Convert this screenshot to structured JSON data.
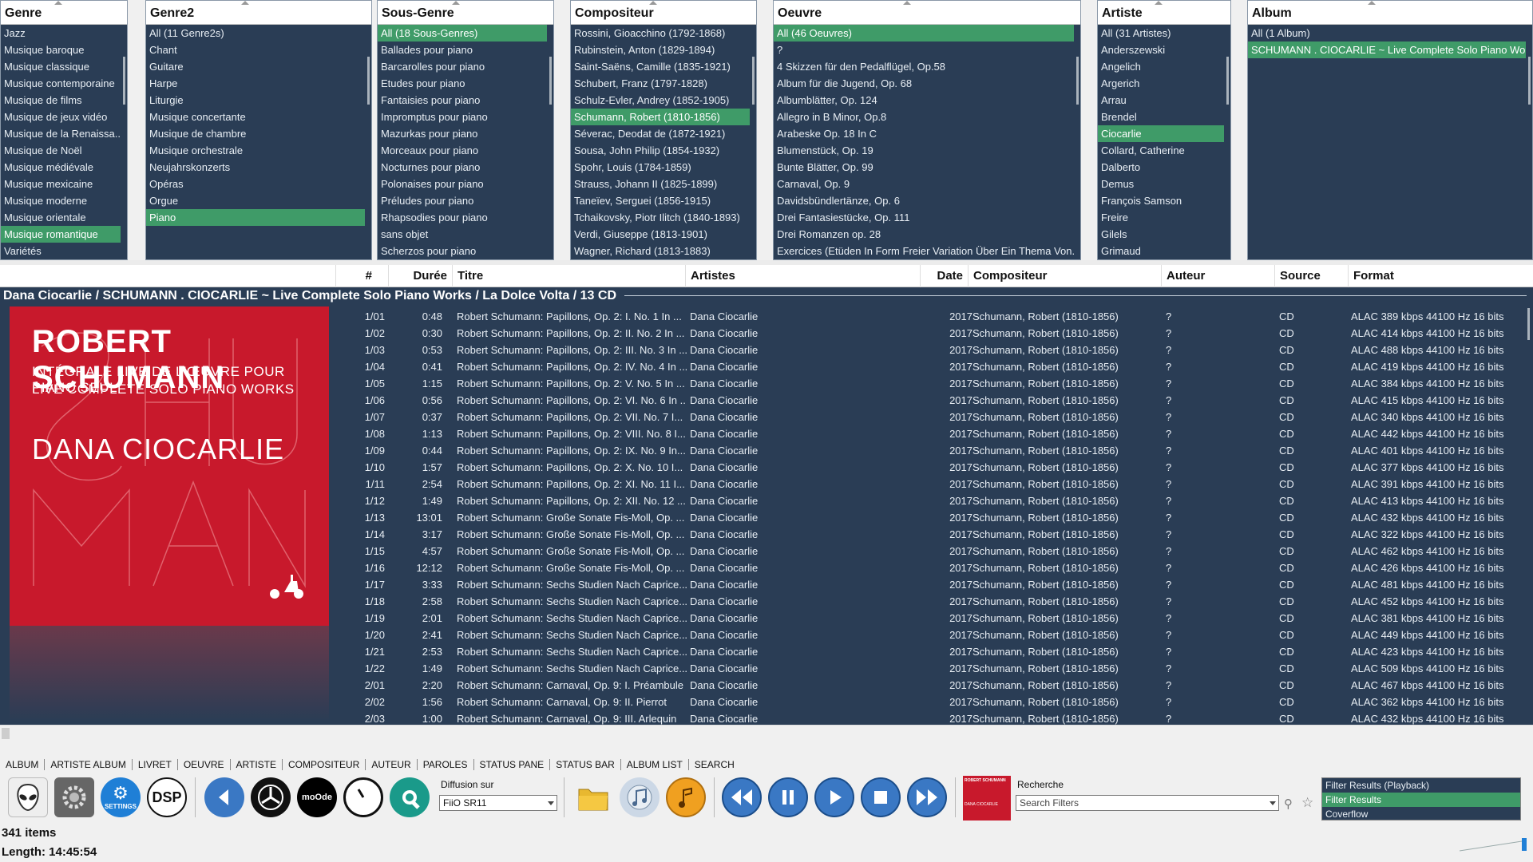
{
  "filters": {
    "genre": {
      "title": "Genre",
      "items": [
        "Jazz",
        "Musique baroque",
        "Musique classique",
        "Musique contemporaine",
        "Musique de films",
        "Musique de jeux vidéo",
        "Musique de la Renaissa...",
        "Musique de Noël",
        "Musique médiévale",
        "Musique mexicaine",
        "Musique moderne",
        "Musique orientale",
        "Musique romantique",
        "Variétés"
      ],
      "selected": 12
    },
    "genre2": {
      "title": "Genre2",
      "items": [
        "All (11 Genre2s)",
        "Chant",
        "Guitare",
        "Harpe",
        "Liturgie",
        "Musique concertante",
        "Musique de chambre",
        "Musique orchestrale",
        "Neujahrskonzerts",
        "Opéras",
        "Orgue",
        "Piano"
      ],
      "selected": 11
    },
    "sousgenre": {
      "title": "Sous-Genre",
      "items": [
        "All (18 Sous-Genres)",
        "Ballades pour piano",
        "Barcarolles pour piano",
        "Etudes pour piano",
        "Fantaisies pour piano",
        "Impromptus pour piano",
        "Mazurkas pour piano",
        "Morceaux pour piano",
        "Nocturnes pour piano",
        "Polonaises pour piano",
        "Préludes pour piano",
        "Rhapsodies pour piano",
        "sans objet",
        "Scherzos pour piano"
      ],
      "selected": 0
    },
    "compositeur": {
      "title": "Compositeur",
      "items": [
        "Rossini, Gioacchino (1792-1868)",
        "Rubinstein, Anton (1829-1894)",
        "Saint-Saëns, Camille (1835-1921)",
        "Schubert, Franz (1797-1828)",
        "Schulz-Evler, Andrey (1852-1905)",
        "Schumann, Robert (1810-1856)",
        "Séverac, Deodat de (1872-1921)",
        "Sousa, John Philip (1854-1932)",
        "Spohr, Louis (1784-1859)",
        "Strauss, Johann II (1825-1899)",
        "Taneïev, Serguei (1856-1915)",
        "Tchaikovsky, Piotr Ilitch (1840-1893)",
        "Verdi, Giuseppe (1813-1901)",
        "Wagner, Richard (1813-1883)"
      ],
      "selected": 5
    },
    "oeuvre": {
      "title": "Oeuvre",
      "items": [
        "All (46 Oeuvres)",
        "?",
        "4 Skizzen für den Pedalflügel, Op.58",
        "Album für die Jugend, Op. 68",
        "Albumblätter, Op. 124",
        "Allegro in B Minor, Op.8",
        "Arabeske Op. 18 In C",
        "Blumenstück, Op. 19",
        "Bunte Blätter, Op. 99",
        "Carnaval, Op. 9",
        "Davidsbündlertänze, Op. 6",
        "Drei Fantasiestücke, Op. 111",
        "Drei Romanzen op. 28",
        "Exercices (Etüden In Form Freier Variation Über Ein Thema Von..."
      ],
      "selected": 0
    },
    "artiste": {
      "title": "Artiste",
      "items": [
        "All (31 Artistes)",
        "Anderszewski",
        "Angelich",
        "Argerich",
        "Arrau",
        "Brendel",
        "Ciocarlie",
        "Collard, Catherine",
        "Dalberto",
        "Demus",
        "François Samson",
        "Freire",
        "Gilels",
        "Grimaud"
      ],
      "selected": 6
    },
    "album": {
      "title": "Album",
      "items": [
        "All (1 Album)",
        "SCHUMANN . CIOCARLIE ~ Live Complete Solo Piano Wo..."
      ],
      "selected": 1
    }
  },
  "columns": [
    "#",
    "Durée",
    "Titre",
    "Artistes",
    "Date",
    "Compositeur",
    "Auteur",
    "Source",
    "Format"
  ],
  "group_header": "Dana Ciocarlie / SCHUMANN . CIOCARLIE ~ Live Complete Solo Piano Works / La Dolce Volta / 13 CD",
  "album_art": {
    "title": "ROBERT SCHUMANN",
    "sub1": "INTÉGRALE LIVE DE L'ŒUVRE POUR PIANO SEUL",
    "sub2": "LIVE COMPLETE SOLO PIANO WORKS",
    "artist": "DANA CIOCARLIE",
    "bg": "#c8192c"
  },
  "tracks": [
    [
      "1/01",
      "0:48",
      "Robert Schumann: Papillons, Op. 2: I. No. 1 In ...",
      "Dana Ciocarlie",
      "2017",
      "Schumann, Robert (1810-1856)",
      "?",
      "CD",
      "ALAC 389 kbps 44100 Hz 16 bits"
    ],
    [
      "1/02",
      "0:30",
      "Robert Schumann: Papillons, Op. 2: II. No. 2 In ...",
      "Dana Ciocarlie",
      "2017",
      "Schumann, Robert (1810-1856)",
      "?",
      "CD",
      "ALAC 414 kbps 44100 Hz 16 bits"
    ],
    [
      "1/03",
      "0:53",
      "Robert Schumann: Papillons, Op. 2: III. No. 3 In ...",
      "Dana Ciocarlie",
      "2017",
      "Schumann, Robert (1810-1856)",
      "?",
      "CD",
      "ALAC 488 kbps 44100 Hz 16 bits"
    ],
    [
      "1/04",
      "0:41",
      "Robert Schumann: Papillons, Op. 2: IV. No. 4 In ...",
      "Dana Ciocarlie",
      "2017",
      "Schumann, Robert (1810-1856)",
      "?",
      "CD",
      "ALAC 419 kbps 44100 Hz 16 bits"
    ],
    [
      "1/05",
      "1:15",
      "Robert Schumann: Papillons, Op. 2: V. No. 5 In ...",
      "Dana Ciocarlie",
      "2017",
      "Schumann, Robert (1810-1856)",
      "?",
      "CD",
      "ALAC 384 kbps 44100 Hz 16 bits"
    ],
    [
      "1/06",
      "0:56",
      "Robert Schumann: Papillons, Op. 2: VI. No. 6 In ...",
      "Dana Ciocarlie",
      "2017",
      "Schumann, Robert (1810-1856)",
      "?",
      "CD",
      "ALAC 415 kbps 44100 Hz 16 bits"
    ],
    [
      "1/07",
      "0:37",
      "Robert Schumann: Papillons, Op. 2: VII. No. 7 I...",
      "Dana Ciocarlie",
      "2017",
      "Schumann, Robert (1810-1856)",
      "?",
      "CD",
      "ALAC 340 kbps 44100 Hz 16 bits"
    ],
    [
      "1/08",
      "1:13",
      "Robert Schumann: Papillons, Op. 2: VIII. No. 8 I...",
      "Dana Ciocarlie",
      "2017",
      "Schumann, Robert (1810-1856)",
      "?",
      "CD",
      "ALAC 442 kbps 44100 Hz 16 bits"
    ],
    [
      "1/09",
      "0:44",
      "Robert Schumann: Papillons, Op. 2: IX. No. 9 In...",
      "Dana Ciocarlie",
      "2017",
      "Schumann, Robert (1810-1856)",
      "?",
      "CD",
      "ALAC 401 kbps 44100 Hz 16 bits"
    ],
    [
      "1/10",
      "1:57",
      "Robert Schumann: Papillons, Op. 2: X. No. 10 I...",
      "Dana Ciocarlie",
      "2017",
      "Schumann, Robert (1810-1856)",
      "?",
      "CD",
      "ALAC 377 kbps 44100 Hz 16 bits"
    ],
    [
      "1/11",
      "2:54",
      "Robert Schumann: Papillons, Op. 2: XI. No. 11 I...",
      "Dana Ciocarlie",
      "2017",
      "Schumann, Robert (1810-1856)",
      "?",
      "CD",
      "ALAC 391 kbps 44100 Hz 16 bits"
    ],
    [
      "1/12",
      "1:49",
      "Robert Schumann: Papillons, Op. 2: XII. No. 12 ...",
      "Dana Ciocarlie",
      "2017",
      "Schumann, Robert (1810-1856)",
      "?",
      "CD",
      "ALAC 413 kbps 44100 Hz 16 bits"
    ],
    [
      "1/13",
      "13:01",
      "Robert Schumann: Große Sonate Fis-Moll, Op. ...",
      "Dana Ciocarlie",
      "2017",
      "Schumann, Robert (1810-1856)",
      "?",
      "CD",
      "ALAC 432 kbps 44100 Hz 16 bits"
    ],
    [
      "1/14",
      "3:17",
      "Robert Schumann: Große Sonate Fis-Moll, Op. ...",
      "Dana Ciocarlie",
      "2017",
      "Schumann, Robert (1810-1856)",
      "?",
      "CD",
      "ALAC 322 kbps 44100 Hz 16 bits"
    ],
    [
      "1/15",
      "4:57",
      "Robert Schumann: Große Sonate Fis-Moll, Op. ...",
      "Dana Ciocarlie",
      "2017",
      "Schumann, Robert (1810-1856)",
      "?",
      "CD",
      "ALAC 462 kbps 44100 Hz 16 bits"
    ],
    [
      "1/16",
      "12:12",
      "Robert Schumann: Große Sonate Fis-Moll, Op. ...",
      "Dana Ciocarlie",
      "2017",
      "Schumann, Robert (1810-1856)",
      "?",
      "CD",
      "ALAC 426 kbps 44100 Hz 16 bits"
    ],
    [
      "1/17",
      "3:33",
      "Robert Schumann: Sechs Studien Nach Caprice...",
      "Dana Ciocarlie",
      "2017",
      "Schumann, Robert (1810-1856)",
      "?",
      "CD",
      "ALAC 481 kbps 44100 Hz 16 bits"
    ],
    [
      "1/18",
      "2:58",
      "Robert Schumann: Sechs Studien Nach Caprice...",
      "Dana Ciocarlie",
      "2017",
      "Schumann, Robert (1810-1856)",
      "?",
      "CD",
      "ALAC 452 kbps 44100 Hz 16 bits"
    ],
    [
      "1/19",
      "2:01",
      "Robert Schumann: Sechs Studien Nach Caprice...",
      "Dana Ciocarlie",
      "2017",
      "Schumann, Robert (1810-1856)",
      "?",
      "CD",
      "ALAC 381 kbps 44100 Hz 16 bits"
    ],
    [
      "1/20",
      "2:41",
      "Robert Schumann: Sechs Studien Nach Caprice...",
      "Dana Ciocarlie",
      "2017",
      "Schumann, Robert (1810-1856)",
      "?",
      "CD",
      "ALAC 449 kbps 44100 Hz 16 bits"
    ],
    [
      "1/21",
      "2:53",
      "Robert Schumann: Sechs Studien Nach Caprice...",
      "Dana Ciocarlie",
      "2017",
      "Schumann, Robert (1810-1856)",
      "?",
      "CD",
      "ALAC 423 kbps 44100 Hz 16 bits"
    ],
    [
      "1/22",
      "1:49",
      "Robert Schumann: Sechs Studien Nach Caprice...",
      "Dana Ciocarlie",
      "2017",
      "Schumann, Robert (1810-1856)",
      "?",
      "CD",
      "ALAC 509 kbps 44100 Hz 16 bits"
    ],
    [
      "2/01",
      "2:20",
      "Robert Schumann: Carnaval, Op. 9: I. Préambule",
      "Dana Ciocarlie",
      "2017",
      "Schumann, Robert (1810-1856)",
      "?",
      "CD",
      "ALAC 467 kbps 44100 Hz 16 bits"
    ],
    [
      "2/02",
      "1:56",
      "Robert Schumann: Carnaval, Op. 9: II. Pierrot",
      "Dana Ciocarlie",
      "2017",
      "Schumann, Robert (1810-1856)",
      "?",
      "CD",
      "ALAC 362 kbps 44100 Hz 16 bits"
    ],
    [
      "2/03",
      "1:00",
      "Robert Schumann: Carnaval, Op. 9: III. Arlequin",
      "Dana Ciocarlie",
      "2017",
      "Schumann, Robert (1810-1856)",
      "?",
      "CD",
      "ALAC 432 kbps 44100 Hz 16 bits"
    ]
  ],
  "tabs": [
    "ALBUM",
    "ARTISTE ALBUM",
    "LIVRET",
    "OEUVRE",
    "ARTISTE",
    "COMPOSITEUR",
    "AUTEUR",
    "PAROLES",
    "STATUS PANE",
    "STATUS BAR",
    "ALBUM LIST",
    "SEARCH"
  ],
  "toolbar": {
    "diffusion_label": "Diffusion sur",
    "diffusion_value": "FiiO SR11",
    "settings_label": "SETTINGS",
    "dsp_label": "DSP",
    "moode_label": "moOde",
    "search_label": "Recherche",
    "search_placeholder": "Search Filters",
    "filter_list": [
      "Filter Results (Playback)",
      "Filter Results",
      "Coverflow"
    ],
    "filter_selected": 1
  },
  "status": {
    "items": "341 items",
    "length": "Length: 14:45:54"
  },
  "colors": {
    "panel_bg": "#2a3d55",
    "selection": "#3f9b68",
    "accent_blue": "#1f7fd6"
  }
}
